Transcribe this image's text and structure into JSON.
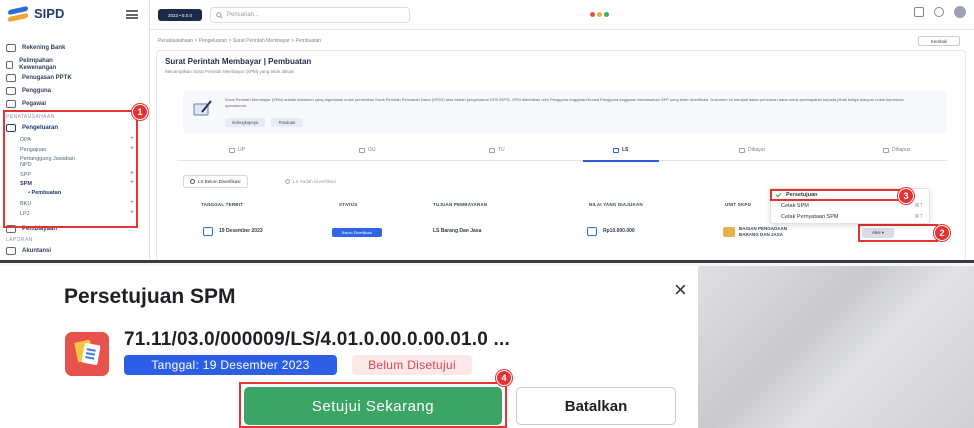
{
  "app": {
    "name": "SIPD"
  },
  "topbar": {
    "pill": "2023 • 5.0.0",
    "search_placeholder": "Pencarian..."
  },
  "sidebar": {
    "items": [
      {
        "label": "Rekening Bank"
      },
      {
        "label": "Pelimpahan Kewenangan"
      },
      {
        "label": "Penugasan PPTK"
      },
      {
        "label": "Pengguna"
      },
      {
        "label": "Pegawai"
      }
    ],
    "section_penatausahaan": "PENATAUSAHAAN",
    "pengeluaran": "Pengeluaran",
    "sub_items": [
      {
        "label": "DPA"
      },
      {
        "label": "Pengajuan"
      },
      {
        "label": "Pertanggung Jawaban NPD"
      },
      {
        "label": "SPP"
      },
      {
        "label": "SPM"
      },
      {
        "label": "• Pembuatan"
      },
      {
        "label": "BKU"
      },
      {
        "label": "LPJ"
      }
    ],
    "pembiayaan": "Pembiayaan",
    "section_laporan": "LAPORAN",
    "akuntansi": "Akuntansi"
  },
  "breadcrumb": "Penatausahaan  >  Pengeluaran  >  Surat Perintah Membayar  >  Pembuatan",
  "breadcrumb_button": "Kembali",
  "page": {
    "title": "Surat Perintah Membayar | Pembuatan",
    "subtitle": "Menampilkan Surat Perintah Membayar (SPM) yang telah dibuat",
    "info": "Surat Perintah Membayar (SPM) adalah dokumen yang digunakan untuk penerbitan Surat Perintah Pencairan Dana (SP2D) atas beban pengeluaran DPA SKPD. SPM diterbitkan oleh Pengguna Anggaran/Kuasa Pengguna Anggaran berdasarkan SPP yang telah diverifikasi. Dokumen ini menjadi dasar pencairan dana untuk pembayaran kepada pihak ketiga maupun untuk keperluan operasional.",
    "info_btn1": "Selengkapnya",
    "info_btn2": "Panduan"
  },
  "tabs": [
    {
      "label": "UP"
    },
    {
      "label": "GU"
    },
    {
      "label": "TU"
    },
    {
      "label": "LS"
    },
    {
      "label": "Dibayar"
    },
    {
      "label": "Dihapus"
    }
  ],
  "subtoggles": {
    "belum": "LS Belum Diverifikasi",
    "sudah": "LS Sudah Diverifikasi"
  },
  "table": {
    "headers": [
      "TANGGAL TERBIT",
      "STATUS",
      "TUJUAN PEMBAYARAN",
      "NILAI YANG DIAJUKAN",
      "UNIT SKPD"
    ],
    "row": {
      "date": "19 Desember 2023",
      "status": "Belum Diverifikasi",
      "tujuan": "LS Barang Dan Jasa",
      "nilai": "Rp10.000.000",
      "unit_line1": "BAGIAN PENGADAAN",
      "unit_line2": "BARANG DAN JASA",
      "aksi": "Aksi  ▾"
    }
  },
  "dropdown": {
    "items": [
      {
        "label": "Persetujuan"
      },
      {
        "label": "Cetak SPM",
        "shortcut": "⌘T"
      },
      {
        "label": "Cetak Pernyataan SPM",
        "shortcut": "⌘T"
      }
    ]
  },
  "steps": [
    "1",
    "2",
    "3",
    "4"
  ],
  "modal": {
    "title": "Persetujuan SPM",
    "close": "×",
    "doc_number": "71.11/03.0/000009/LS/4.01.0.00.0.00.01.0 ...",
    "date_label": "Tanggal: 19 Desember 2023",
    "status": "Belum Disetujui",
    "approve": "Setujui Sekarang",
    "cancel": "Batalkan"
  },
  "colors": {
    "accent": "#2d5ee6",
    "success": "#3aa565",
    "marker": "#e53232",
    "danger_text": "#e04455"
  }
}
